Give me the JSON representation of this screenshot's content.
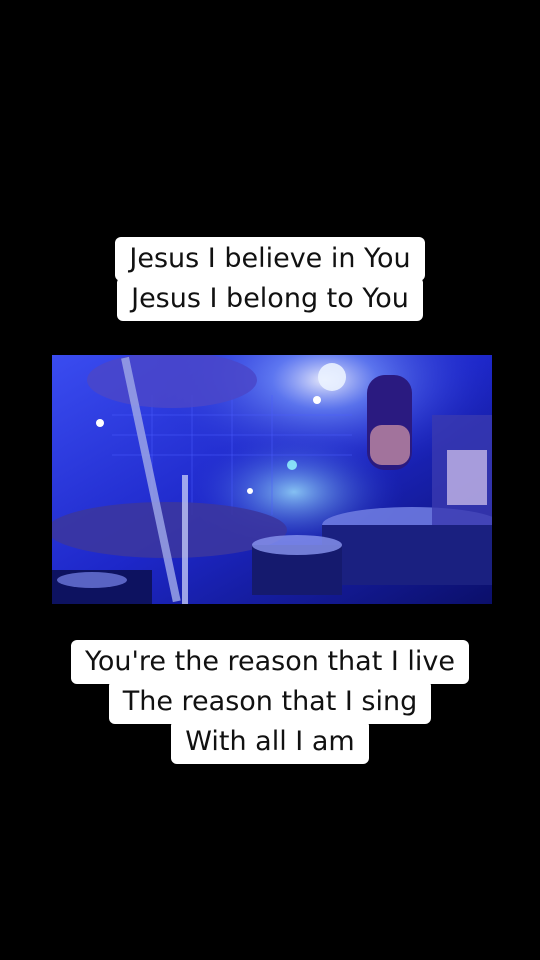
{
  "captions": {
    "top": {
      "lines": [
        "Jesus I believe in You",
        "Jesus I belong to You"
      ]
    },
    "bottom": {
      "lines": [
        "You're the reason that I live",
        "The reason that I sing",
        "With all I am"
      ]
    }
  },
  "video": {
    "description_icon": "drum-kit-stage-scene",
    "colors": {
      "stage_blue": "#1f2bd6",
      "light_blue": "#5a7cff",
      "deep_blue": "#0c1170",
      "white_light": "#eaf2ff"
    }
  }
}
